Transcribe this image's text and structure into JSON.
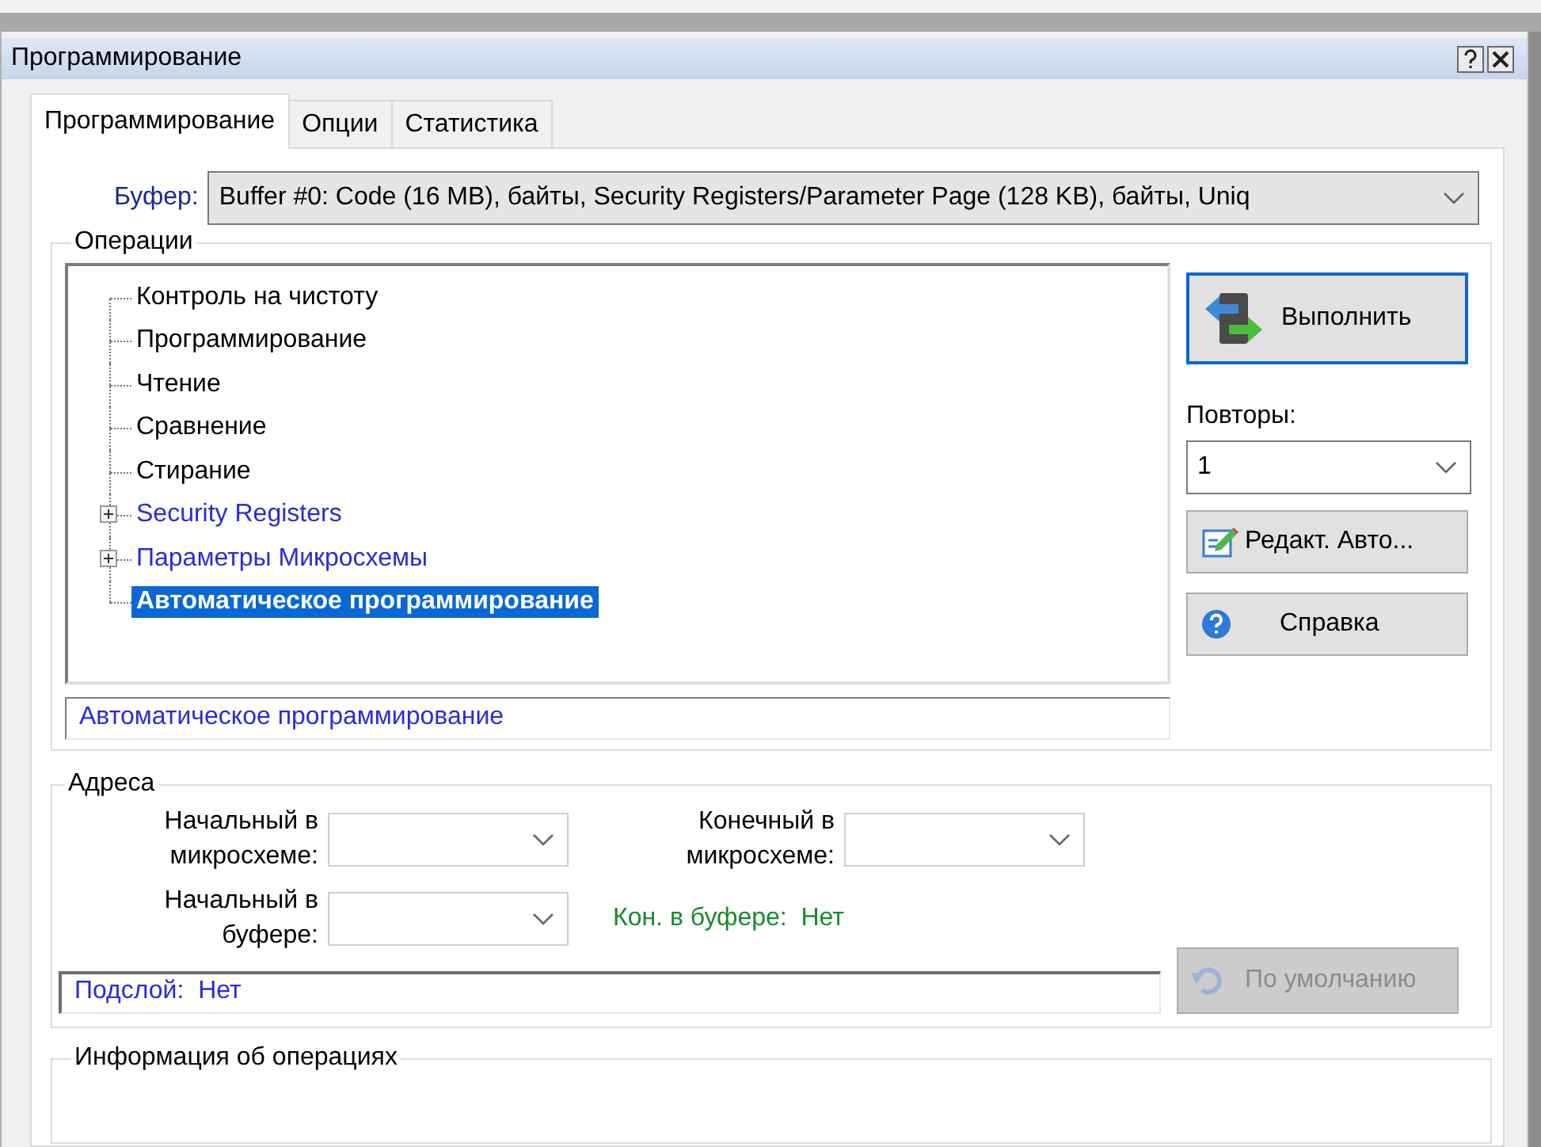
{
  "window": {
    "title": "Программирование"
  },
  "tabs": [
    {
      "label": "Программирование",
      "selected": true
    },
    {
      "label": "Опции",
      "selected": false
    },
    {
      "label": "Статистика",
      "selected": false
    }
  ],
  "buffer": {
    "label": "Буфер:",
    "value": "Buffer #0:  Code (16 MB), байты, Security Registers/Parameter Page (128 KB), байты, Uniq"
  },
  "operations": {
    "title": "Операции",
    "tree": [
      {
        "label": "Контроль на чистоту",
        "kind": "operation",
        "selected": false
      },
      {
        "label": "Программирование",
        "kind": "operation",
        "selected": false
      },
      {
        "label": "Чтение",
        "kind": "operation",
        "selected": false
      },
      {
        "label": "Сравнение",
        "kind": "operation",
        "selected": false
      },
      {
        "label": "Стирание",
        "kind": "operation",
        "selected": false
      },
      {
        "label": "Security Registers",
        "kind": "group",
        "expanded": false,
        "selected": false
      },
      {
        "label": "Параметры Микросхемы",
        "kind": "group",
        "expanded": false,
        "selected": false
      },
      {
        "label": "Автоматическое программирование",
        "kind": "operation",
        "selected": true
      }
    ],
    "description": "Автоматическое программирование",
    "run_button": "Выполнить",
    "repeats_label": "Повторы:",
    "repeats_value": "1",
    "edit_button": "Редакт. Авто...",
    "help_button": "Справка"
  },
  "addresses": {
    "title": "Адреса",
    "chip_start_label": "Начальный в микросхеме:",
    "chip_end_label": "Конечный в микросхеме:",
    "buffer_start_label": "Начальный в буфере:",
    "buffer_end": "Кон. в буфере:  Нет",
    "sublayer": "Подслой:  Нет",
    "default_button": {
      "label": "По умолчанию",
      "disabled": true
    }
  },
  "info": {
    "title": "Информация об операциях"
  }
}
